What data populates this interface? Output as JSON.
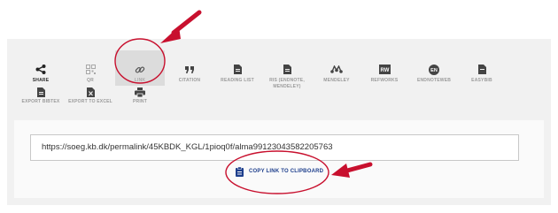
{
  "actions_row1": [
    {
      "label": "SHARE",
      "icon": "share-icon"
    },
    {
      "label": "QR",
      "icon": "qr-code-icon"
    },
    {
      "label": "LINK",
      "icon": "link-icon",
      "selected": true
    },
    {
      "label": "CITATION",
      "icon": "quote-icon"
    },
    {
      "label": "READING LIST",
      "icon": "document-icon"
    },
    {
      "label": "RIS (ENDNOTE, MENDELEY)",
      "icon": "document-icon"
    },
    {
      "label": "MENDELEY",
      "icon": "mendeley-icon"
    },
    {
      "label": "REFWORKS",
      "icon": "refworks-icon",
      "badge": "RW"
    },
    {
      "label": "ENDNOTEWEB",
      "icon": "endnoteweb-icon",
      "badge": "EN"
    },
    {
      "label": "EASYBIB",
      "icon": "easybib-icon"
    }
  ],
  "actions_row2": [
    {
      "label": "EXPORT BIBTEX",
      "icon": "document-icon"
    },
    {
      "label": "EXPORT TO EXCEL",
      "icon": "excel-icon"
    },
    {
      "label": "PRINT",
      "icon": "print-icon"
    }
  ],
  "permalink": {
    "url": "https://soeg.kb.dk/permalink/45KBDK_KGL/1pioq0f/alma99123043582205763"
  },
  "copy_button": {
    "label": "COPY LINK TO CLIPBOARD",
    "icon": "clipboard-icon"
  },
  "colors": {
    "annotation": "#c8102e",
    "accent": "#1d3e8c",
    "panel": "#f1f1f1"
  }
}
